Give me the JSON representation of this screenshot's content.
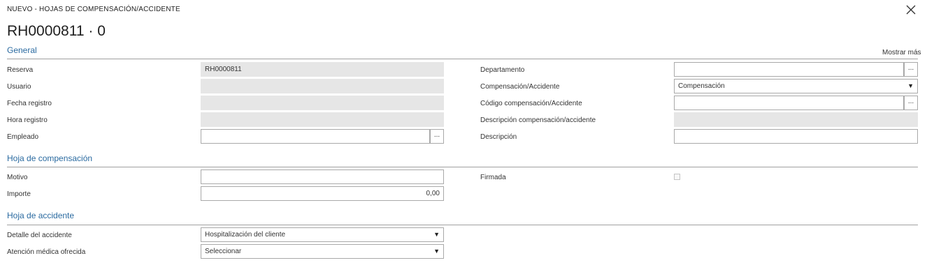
{
  "window": {
    "title": "NUEVO - HOJAS DE COMPENSACIÓN/ACCIDENTE",
    "record": "RH0000811 · 0",
    "show_more": "Mostrar más"
  },
  "general": {
    "title": "General",
    "reserva": {
      "label": "Reserva",
      "value": "RH0000811"
    },
    "usuario": {
      "label": "Usuario",
      "value": ""
    },
    "fecha_registro": {
      "label": "Fecha registro",
      "value": ""
    },
    "hora_registro": {
      "label": "Hora registro",
      "value": ""
    },
    "empleado": {
      "label": "Empleado",
      "value": ""
    },
    "departamento": {
      "label": "Departamento",
      "value": ""
    },
    "comp_acc": {
      "label": "Compensación/Accidente",
      "value": "Compensación"
    },
    "codigo": {
      "label": "Código compensación/Accidente",
      "value": ""
    },
    "descripcion_comp": {
      "label": "Descripción compensación/accidente",
      "value": ""
    },
    "descripcion": {
      "label": "Descripción",
      "value": ""
    }
  },
  "compensacion": {
    "title": "Hoja de compensación",
    "motivo": {
      "label": "Motivo",
      "value": ""
    },
    "importe": {
      "label": "Importe",
      "value": "0,00"
    },
    "firmada": {
      "label": "Firmada",
      "checked": false
    }
  },
  "accidente": {
    "title": "Hoja de accidente",
    "detalle": {
      "label": "Detalle del accidente",
      "value": "Hospitalización del cliente"
    },
    "atencion": {
      "label": "Atención médica ofrecida",
      "value": "Seleccionar"
    }
  },
  "icons": {
    "close": "close-icon",
    "lookup": "...",
    "dropdown": "▼"
  },
  "colors": {
    "section_title": "#2a6aa0",
    "readonly_bg": "#e6e6e6",
    "border": "#a9a9a9"
  }
}
